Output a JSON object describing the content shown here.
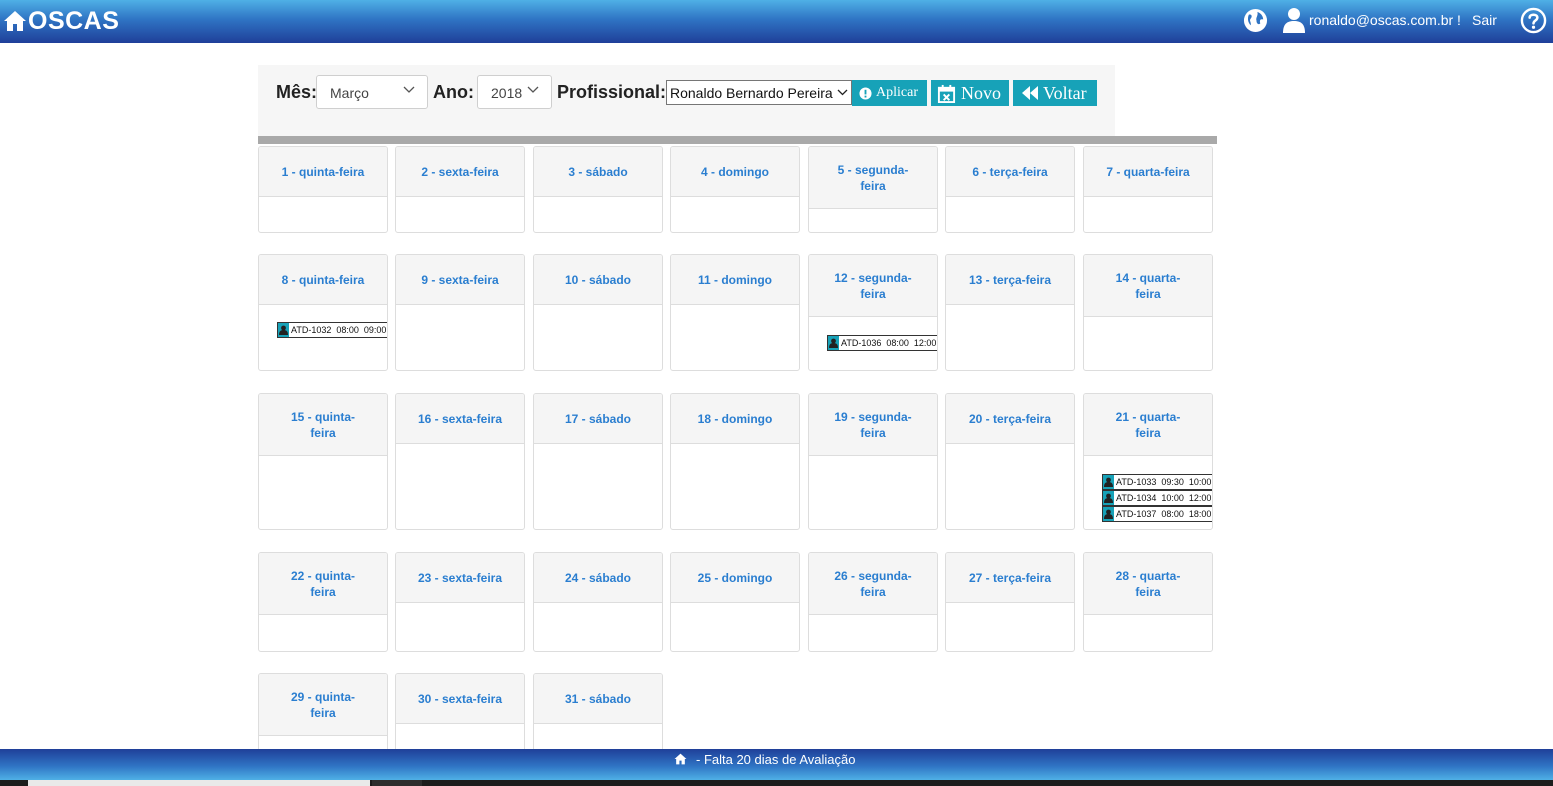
{
  "app": {
    "brand": "OSCAS",
    "user_email": "ronaldo@oscas.com.br !",
    "logout_label": "Sair"
  },
  "filters": {
    "month_label": "Mês:",
    "month_value": "Março",
    "year_label": "Ano:",
    "year_value": "2018",
    "professional_label": "Profissional:",
    "professional_value": "Ronaldo Bernardo Pereira",
    "apply_label": "Aplicar",
    "new_label": "Novo",
    "back_label": "Voltar"
  },
  "calendar": {
    "weeks": [
      {
        "days": [
          {
            "label": "1 - quinta-feira",
            "appointments": []
          },
          {
            "label": "2 - sexta-feira",
            "appointments": []
          },
          {
            "label": "3 - sábado",
            "appointments": []
          },
          {
            "label": "4 - domingo",
            "appointments": []
          },
          {
            "label": "5 - segunda-feira",
            "appointments": []
          },
          {
            "label": "6 - terça-feira",
            "appointments": []
          },
          {
            "label": "7 - quarta-feira",
            "appointments": []
          }
        ]
      },
      {
        "days": [
          {
            "label": "8 - quinta-feira",
            "appointments": [
              {
                "text": "ATD-1032  08:00  09:00"
              }
            ]
          },
          {
            "label": "9 - sexta-feira",
            "appointments": []
          },
          {
            "label": "10 - sábado",
            "appointments": []
          },
          {
            "label": "11 - domingo",
            "appointments": []
          },
          {
            "label": "12 - segunda-feira",
            "appointments": [
              {
                "text": "ATD-1036  08:00  12:00"
              }
            ]
          },
          {
            "label": "13 - terça-feira",
            "appointments": []
          },
          {
            "label": "14 - quarta-feira",
            "appointments": []
          }
        ]
      },
      {
        "days": [
          {
            "label": "15 - quinta-feira",
            "appointments": []
          },
          {
            "label": "16 - sexta-feira",
            "appointments": []
          },
          {
            "label": "17 - sábado",
            "appointments": []
          },
          {
            "label": "18 - domingo",
            "appointments": []
          },
          {
            "label": "19 - segunda-feira",
            "appointments": []
          },
          {
            "label": "20 - terça-feira",
            "appointments": []
          },
          {
            "label": "21 - quarta-feira",
            "appointments": [
              {
                "text": "ATD-1033  09:30  10:00"
              },
              {
                "text": "ATD-1034  10:00  12:00"
              },
              {
                "text": "ATD-1037  08:00  18:00"
              }
            ]
          }
        ]
      },
      {
        "days": [
          {
            "label": "22 - quinta-feira",
            "appointments": []
          },
          {
            "label": "23 - sexta-feira",
            "appointments": []
          },
          {
            "label": "24 - sábado",
            "appointments": []
          },
          {
            "label": "25 - domingo",
            "appointments": []
          },
          {
            "label": "26 - segunda-feira",
            "appointments": []
          },
          {
            "label": "27 - terça-feira",
            "appointments": []
          },
          {
            "label": "28 - quarta-feira",
            "appointments": []
          }
        ]
      },
      {
        "days": [
          {
            "label": "29 - quinta-feira",
            "appointments": []
          },
          {
            "label": "30 - sexta-feira",
            "appointments": []
          },
          {
            "label": "31 - sábado",
            "appointments": []
          }
        ]
      }
    ]
  },
  "footer": {
    "message": "- Falta 20 dias de Avaliação"
  },
  "colors": {
    "accent": "#17a2b8",
    "day_link": "#2a7ed0",
    "header_gradient_top": "#4fb0e6",
    "header_gradient_bottom": "#1f3f99"
  },
  "icons": [
    "home-icon",
    "globe-icon",
    "user-icon",
    "help-icon",
    "info-icon",
    "calendar-x-icon",
    "double-back-icon",
    "chevron-down-icon",
    "person-icon"
  ]
}
